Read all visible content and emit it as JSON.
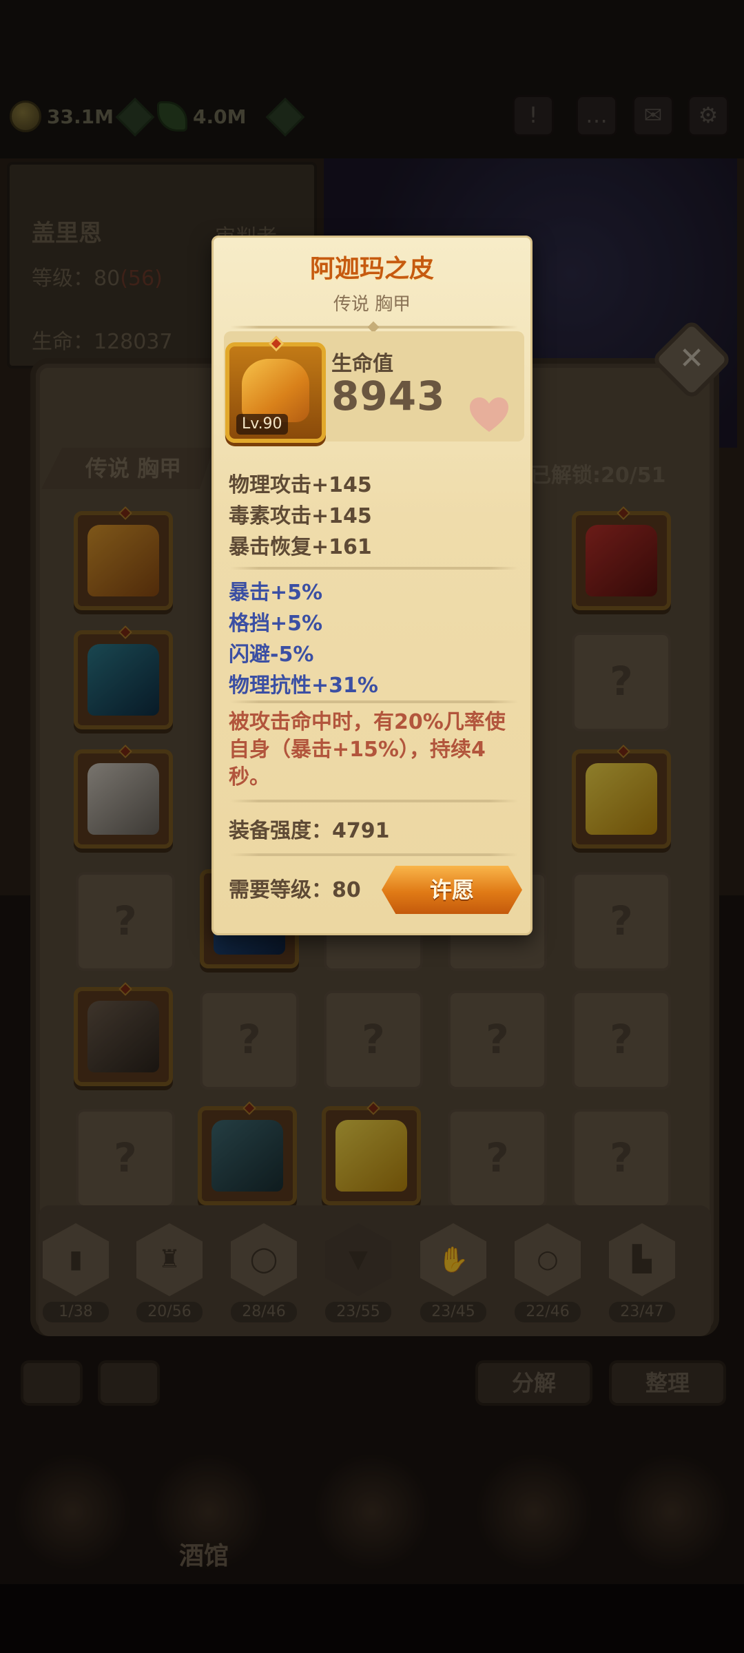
{
  "currency": {
    "gold": "33.1M",
    "gems": "4.0M"
  },
  "hero": {
    "name": "盖里恩",
    "role": "审判者",
    "level_label": "等级：",
    "level": "80",
    "level_bonus": "(56)",
    "hp_label": "生命：",
    "hp": "128037"
  },
  "inventory": {
    "header": "传说 胸甲",
    "unlocked": "已解锁:20/51",
    "unknown_mark": "?",
    "categories": [
      {
        "count": "1/38",
        "icon": "book-icon"
      },
      {
        "count": "20/56",
        "icon": "bear-helm-icon"
      },
      {
        "count": "28/46",
        "icon": "necklace-icon"
      },
      {
        "count": "23/55",
        "icon": "shirt-icon",
        "selected": true
      },
      {
        "count": "23/45",
        "icon": "glove-icon"
      },
      {
        "count": "22/46",
        "icon": "ring-icon"
      },
      {
        "count": "23/47",
        "icon": "boot-icon"
      }
    ],
    "buttons": {
      "decompose": "分解",
      "sort": "整理"
    }
  },
  "nav": {
    "tavern": "酒馆"
  },
  "tooltip": {
    "name": "阿迦玛之皮",
    "subtitle": "传说 胸甲",
    "level_badge": "Lv.90",
    "hp_label": "生命值",
    "hp_value": "8943",
    "base_stats": [
      "物理攻击+145",
      "毒素攻击+145",
      "暴击恢复+161"
    ],
    "bonus_stats": [
      "暴击+5%",
      "格挡+5%",
      "闪避-5%",
      "物理抗性+31%"
    ],
    "effect": "被攻击命中时，有20%几率使自身（暴击+15%），持续4秒。",
    "power": "装备强度：4791",
    "requirement": "需要等级：80",
    "wish_button": "许愿"
  },
  "colors": {
    "title_orange": "#c65a0f",
    "bonus_blue": "#3b4fa3",
    "effect_red": "#b2553c",
    "parchment": "#efdcab"
  }
}
